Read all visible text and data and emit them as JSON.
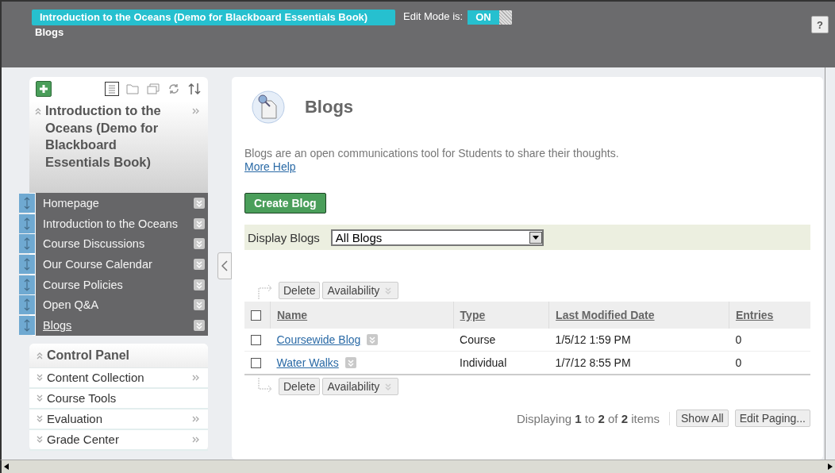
{
  "header": {
    "course_title": "Introduction to the Oceans (Demo for Blackboard Essentials Book)",
    "breadcrumb": "Blogs",
    "edit_mode_label": "Edit Mode is:",
    "edit_mode": {
      "label": "ON",
      "on": true
    },
    "help": "?"
  },
  "course_menu": {
    "title": "Introduction to the Oceans (Demo for Blackboard Essentials Book)",
    "items": [
      {
        "label": "Homepage",
        "selected": false
      },
      {
        "label": "Introduction to the Oceans",
        "selected": false
      },
      {
        "label": "Course Discussions",
        "selected": false
      },
      {
        "label": "Our Course Calendar",
        "selected": false
      },
      {
        "label": "Course Policies",
        "selected": false
      },
      {
        "label": "Open Q&A",
        "selected": false
      },
      {
        "label": "Blogs",
        "selected": true
      }
    ]
  },
  "control_panel": {
    "title": "Control Panel",
    "items": [
      {
        "label": "Content Collection",
        "has_submenu": true
      },
      {
        "label": "Course Tools",
        "has_submenu": false
      },
      {
        "label": "Evaluation",
        "has_submenu": true
      },
      {
        "label": "Grade Center",
        "has_submenu": true
      }
    ]
  },
  "page": {
    "title": "Blogs",
    "description": "Blogs are an open communications tool for Students to share their thoughts.",
    "help_link": "More Help",
    "create_button": "Create Blog",
    "filter": {
      "label": "Display Blogs",
      "value": "All Blogs"
    },
    "top_actions": [
      "Delete",
      "Availability"
    ],
    "table": {
      "columns": [
        "Name",
        "Type",
        "Last Modified Date",
        "Entries"
      ],
      "header_checked": false,
      "rows": [
        {
          "name": "Coursewide Blog",
          "type": "Course",
          "date": "1/5/12 1:59 PM",
          "entries": "0",
          "checked": false
        },
        {
          "name": "Water Walks",
          "type": "Individual",
          "date": "1/7/12 8:55 PM",
          "entries": "0",
          "checked": false
        }
      ]
    },
    "bottom_actions": [
      "Delete",
      "Availability"
    ],
    "paging": {
      "text": "Displaying **1** to **2** of **2** items",
      "buttons": [
        "Show All",
        "Edit Paging..."
      ]
    }
  }
}
